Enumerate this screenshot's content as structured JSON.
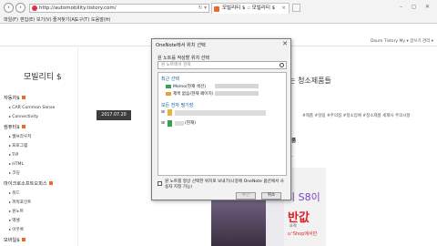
{
  "browser": {
    "address": "http://automobility.tistory.com/",
    "tab_title": "모빌리티 $ :: 모빌리티 $",
    "menu": [
      "파일(F)",
      "편집(E)",
      "보기(V)",
      "즐겨찾기(A)",
      "도구(T)",
      "도움말(H)"
    ],
    "win_controls": "– ◻ ✕"
  },
  "blog": {
    "top_links": "Daum  Tistory  My ▾  글쓰기  관리  ▾",
    "title": "모빌리티 $",
    "categories": [
      {
        "label": "자동차$",
        "subs": [
          "CAR Common Sense",
          "Connectivity"
        ]
      },
      {
        "label": "컴퓨터$",
        "subs": [
          "웹브라우저",
          "프로그램",
          "TIP",
          "HTML",
          "코딩"
        ]
      },
      {
        "label": "마이크로소프트오피스",
        "subs": [
          "워드",
          "파워포인트",
          "원노트",
          "엑셀",
          "아웃룩"
        ]
      },
      {
        "label": "모바일$",
        "subs": []
      }
    ],
    "post_title": "면 안 되는 청소제품들",
    "date": "2017.07.20 11:24",
    "tags": "#제품 #살림 #주의점 #청소업체 #청소제품 세제사 주의사항",
    "p1": "연",
    "p2": "소제품",
    "p3": "니다."
  },
  "ad": {
    "headline": "시 S8이",
    "price": "반값",
    "small": "오직",
    "shop": "u⁺Shop에서만"
  },
  "dialog": {
    "title": "OneNote에서 위치 선택",
    "close": "✕",
    "prompt": "원 노트를 작성할 위치 선택",
    "search_placeholder": "원 노트에서 검색",
    "recent_header": "최근 선택",
    "recent": [
      "Memo(현재 섹션)",
      "제목 없음(현재 페이지)"
    ],
    "all_header": "모든 전자 필기장",
    "notebook2": "(현재)",
    "checkbox_label": "원 노트를 항상 선택한 위치로 보내기(나중에 OneNote 옵션에서 사용자 지정 가능)",
    "move_button": "확인",
    "cancel_button": "취소"
  }
}
